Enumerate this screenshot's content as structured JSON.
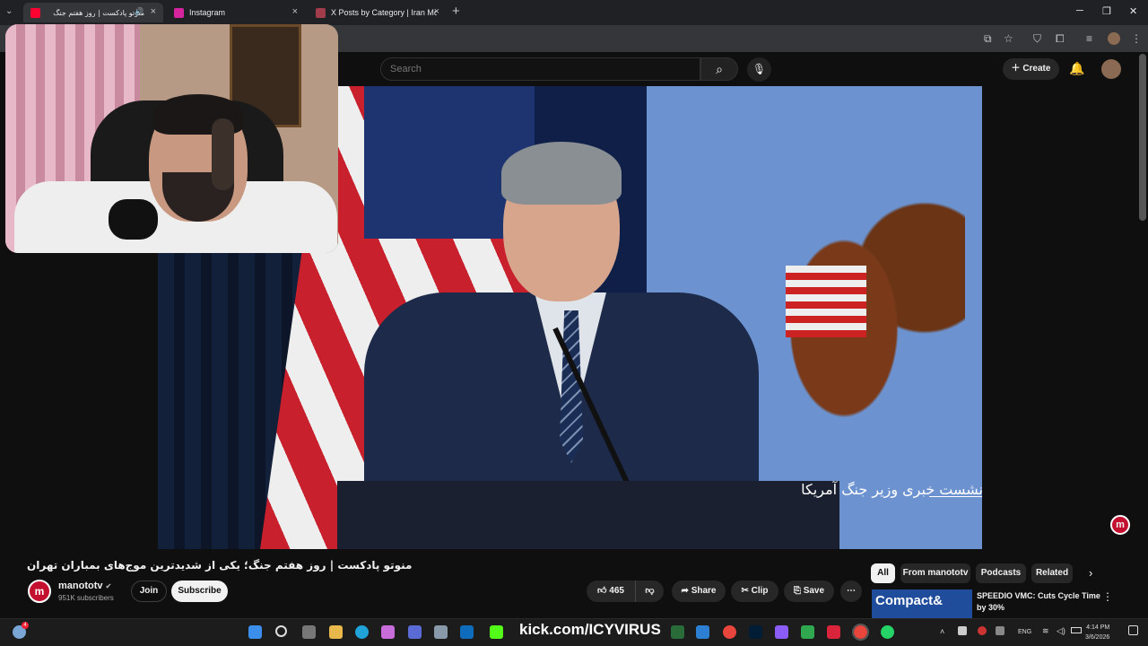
{
  "browser": {
    "tabs": [
      {
        "label": "منوتو پادکست | روز هفتم جنگ",
        "favicon_color": "#ff0033",
        "active": true
      },
      {
        "label": "Instagram",
        "favicon_color": "#d6249f",
        "active": false
      },
      {
        "label": "X Posts by Category | Iran Mon",
        "favicon_color": "#a23b4a",
        "active": false
      }
    ],
    "new_tab": "+",
    "window_controls": {
      "minimize": "─",
      "maximize": "❐",
      "close": "✕"
    },
    "menu_icon": "⌄"
  },
  "youtube": {
    "search_placeholder": "Search",
    "create_label": "Create",
    "video": {
      "caption": "نشست خبری وزیر جنگ آمریکا",
      "title": "منوتو پادکست | روز هفتم جنگ؛ یکی از شدیدترین موج‌های بمباران تهران"
    },
    "channel": {
      "name": "manototv",
      "verified": "✔",
      "subscribers": "951K subscribers",
      "avatar_letter": "m"
    },
    "buttons": {
      "join": "Join",
      "subscribe": "Subscribe",
      "likes": "465",
      "share": "Share",
      "clip": "Clip",
      "save": "Save",
      "more": "⋯"
    },
    "chips": [
      "All",
      "From manototv",
      "Podcasts",
      "Related"
    ],
    "recommendation": {
      "thumb_text": "Compact&",
      "title": "SPEEDIO VMC: Cuts Cycle Time by 30%"
    }
  },
  "taskbar": {
    "kick_prefix": "kick.com/",
    "kick_user": "ICYVIRUS",
    "language": "ENG",
    "time": "4:14 PM",
    "date": "3/6/2026",
    "notification_badge": "4"
  },
  "colors": {
    "accent_red": "#ff0033",
    "background": "#0f0f0f",
    "kick_green": "#53fc18"
  }
}
